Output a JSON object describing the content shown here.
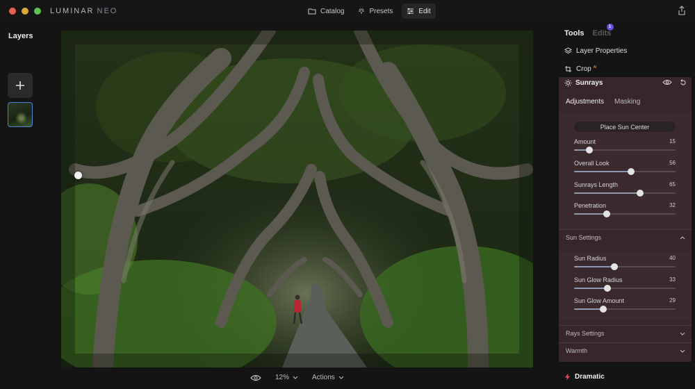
{
  "app": {
    "logo_main": "LUMINAR",
    "logo_sub": "NEO"
  },
  "window_controls": {
    "close_color": "#ec5f58",
    "minimize_color": "#dfa63c",
    "zoom_color": "#5fc153"
  },
  "topnav": [
    {
      "label": "Catalog",
      "icon": "folder-icon"
    },
    {
      "label": "Presets",
      "icon": "sparkle-icon"
    },
    {
      "label": "Edit",
      "icon": "sliders-icon",
      "active": true
    }
  ],
  "layers": {
    "title": "Layers"
  },
  "bottombar": {
    "zoom": "12%",
    "actions": "Actions"
  },
  "panel": {
    "tab_tools": "Tools",
    "tab_edits": "Edits",
    "edits_badge": "1",
    "layer_properties": "Layer Properties",
    "crop": "Crop",
    "crop_tag": "AI",
    "sunrays": {
      "title": "Sunrays",
      "tab_adjustments": "Adjustments",
      "tab_masking": "Masking",
      "place_sun": "Place Sun Center",
      "sliders": [
        {
          "label": "Amount",
          "value": "15",
          "level": 0.15
        },
        {
          "label": "Overall Look",
          "value": "56",
          "level": 0.56
        },
        {
          "label": "Sunrays Length",
          "value": "65",
          "level": 0.65
        },
        {
          "label": "Penetration",
          "value": "32",
          "level": 0.32
        }
      ],
      "sun_settings": "Sun Settings",
      "sun_sliders": [
        {
          "label": "Sun Radius",
          "value": "40",
          "level": 0.4
        },
        {
          "label": "Sun Glow Radius",
          "value": "33",
          "level": 0.33
        },
        {
          "label": "Sun Glow Amount",
          "value": "29",
          "level": 0.29
        }
      ],
      "rays_settings": "Rays Settings",
      "warmth": "Warmth"
    },
    "dramatic": "Dramatic"
  }
}
